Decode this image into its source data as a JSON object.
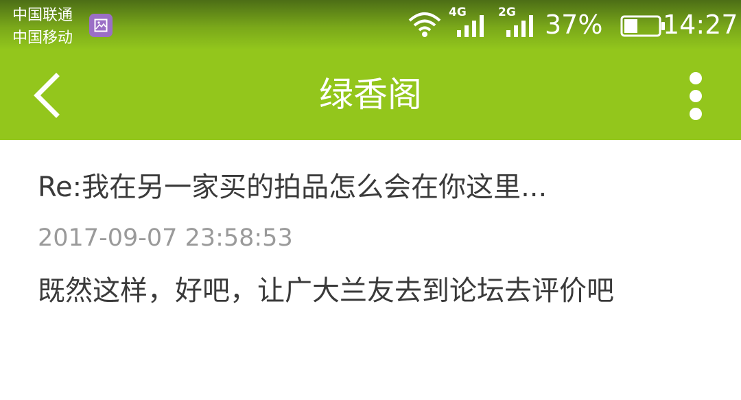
{
  "status_bar": {
    "carriers": [
      "中国联通",
      "中国移动"
    ],
    "notification_icon": "image-icon",
    "signal_1_type": "4G",
    "signal_2_type": "2G",
    "battery_percent": "37%",
    "time": "14:27"
  },
  "header": {
    "title": "绿香阁",
    "back_icon": "chevron-left-icon",
    "menu_icon": "more-vertical-icon",
    "color": "#93c61c"
  },
  "message": {
    "title": "Re:我在另一家买的拍品怎么会在你这里...",
    "timestamp": "2017-09-07 23:58:53",
    "body": "既然这样，好吧，让广大兰友去到论坛去评价吧"
  }
}
